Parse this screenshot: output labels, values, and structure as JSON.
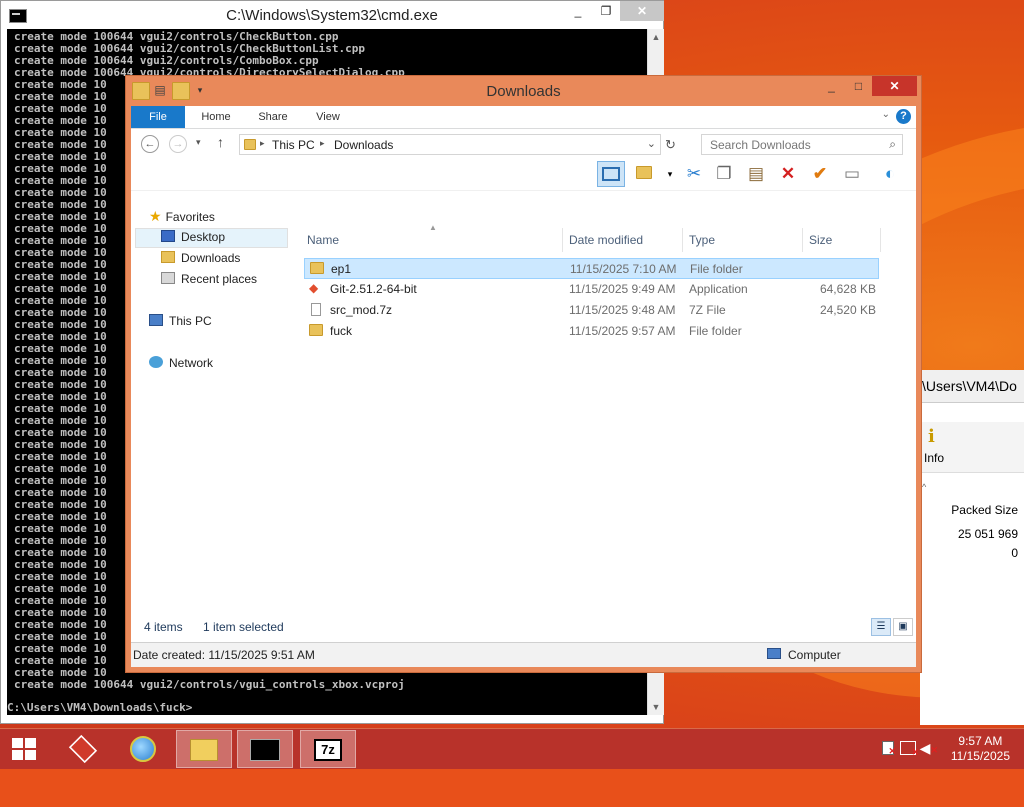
{
  "cmd": {
    "title": "C:\\Windows\\System32\\cmd.exe",
    "minimize": "_",
    "maximize": "❐",
    "close": "✕",
    "lines": [
      "create mode 100644 vgui2/controls/CheckButton.cpp",
      "create mode 100644 vgui2/controls/CheckButtonList.cpp",
      "create mode 100644 vgui2/controls/ComboBox.cpp",
      "create mode 100644 vgui2/controls/DirectorySelectDialog.cpp",
      "create mode 10",
      "create mode 10",
      "create mode 10",
      "create mode 10",
      "create mode 10",
      "create mode 10",
      "create mode 10",
      "create mode 10",
      "create mode 10",
      "create mode 10",
      "create mode 10",
      "create mode 10",
      "create mode 10",
      "create mode 10",
      "create mode 10",
      "create mode 10",
      "create mode 10",
      "create mode 10",
      "create mode 10",
      "create mode 10",
      "create mode 10",
      "create mode 10",
      "create mode 10",
      "create mode 10",
      "create mode 10",
      "create mode 10",
      "create mode 10",
      "create mode 10",
      "create mode 10",
      "create mode 10",
      "create mode 10",
      "create mode 10",
      "create mode 10",
      "create mode 10",
      "create mode 10",
      "create mode 10",
      "create mode 10",
      "create mode 10",
      "create mode 10",
      "create mode 10",
      "create mode 10",
      "create mode 10",
      "create mode 10",
      "create mode 10",
      "create mode 10",
      "create mode 10",
      "create mode 10",
      "create mode 10",
      "create mode 10",
      "create mode 10",
      "create mode 100644 vgui2/controls/vgui_controls_xbox.vcproj"
    ],
    "prompt": "C:\\Users\\VM4\\Downloads\\fuck>"
  },
  "explorer": {
    "title": "Downloads",
    "minimize": "_",
    "maximize": "□",
    "close": "✕",
    "tabs": [
      "File",
      "Home",
      "Share",
      "View"
    ],
    "help": "?",
    "breadcrumb": [
      "This PC",
      "Downloads"
    ],
    "search_placeholder": "Search Downloads",
    "nav": {
      "favorites": "Favorites",
      "desktop": "Desktop",
      "downloads": "Downloads",
      "recent": "Recent places",
      "this_pc": "This PC",
      "network": "Network"
    },
    "columns": {
      "name": "Name",
      "date": "Date modified",
      "type": "Type",
      "size": "Size"
    },
    "files": [
      {
        "name": "ep1",
        "date": "11/15/2025 7:10 AM",
        "type": "File folder",
        "size": "",
        "icon": "folder-icon"
      },
      {
        "name": "Git-2.51.2-64-bit",
        "date": "11/15/2025 9:49 AM",
        "type": "Application",
        "size": "64,628 KB",
        "icon": "git-icon"
      },
      {
        "name": "src_mod.7z",
        "date": "11/15/2025 9:48 AM",
        "type": "7Z File",
        "size": "24,520 KB",
        "icon": "file-icon"
      },
      {
        "name": "fuck",
        "date": "11/15/2025 9:57 AM",
        "type": "File folder",
        "size": "",
        "icon": "folder-icon"
      }
    ],
    "status_items": "4 items",
    "status_selected": "1 item selected",
    "details": "Date created: 11/15/2025 9:51 AM",
    "computer": "Computer"
  },
  "sevenzip": {
    "path": "\\Users\\VM4\\Do",
    "info": "Info",
    "packed_size_label": "Packed Size",
    "values": [
      "25 051 969",
      "0"
    ]
  },
  "taskbar": {
    "time": "9:57 AM",
    "date": "11/15/2025",
    "accent": "#b8322a"
  }
}
